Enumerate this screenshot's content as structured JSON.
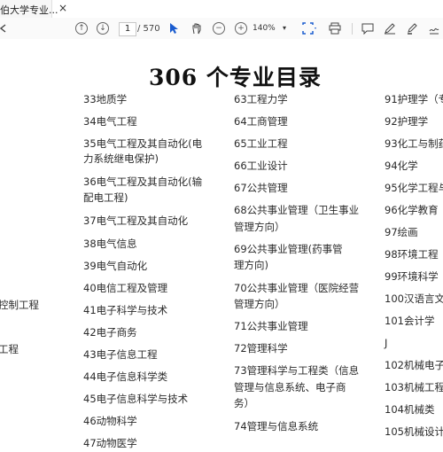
{
  "tab": {
    "title": "伯大学专业...",
    "close": "×"
  },
  "toolbar": {
    "page_current": "1",
    "page_total": "/ 570",
    "zoom": "140%"
  },
  "document": {
    "heading": "306 个专业目录",
    "col0": [
      "控制工程",
      "工程"
    ],
    "col1": [
      "33地质学",
      "34电气工程",
      "35电气工程及其自动化(电",
      "力系统继电保护)",
      "36电气工程及其自动化(输",
      "配电工程)",
      "37电气工程及其自动化",
      "38电气信息",
      "39电气自动化",
      "40电信工程及管理",
      "41电子科学与技术",
      "42电子商务",
      "43电子信息工程",
      "44电子信息科学类",
      "45电子信息科学与技术",
      "46动物科学",
      "47动物医学"
    ],
    "col2": [
      "63工程力学",
      "64工商管理",
      "65工业工程",
      "66工业设计",
      "67公共管理",
      "68公共事业管理（卫生事业",
      "管理方向）",
      "69公共事业管理(药事管",
      "理方向)",
      "70公共事业管理（医院经营",
      "管理方向）",
      "71公共事业管理",
      "72管理科学",
      "73管理科学与工程类（信息",
      "管理与信息系统、电子商",
      "务）",
      "74管理与信息系统"
    ],
    "col3": [
      "91护理学（专",
      "92护理学",
      "93化工与制药",
      "94化学",
      "95化学工程与",
      "96化学教育",
      "97绘画",
      "98环境工程",
      "99环境科学",
      "100汉语言文",
      "101会计学",
      "J",
      "102机械电子",
      "103机械工程",
      "104机械类",
      "105机械设计"
    ]
  }
}
